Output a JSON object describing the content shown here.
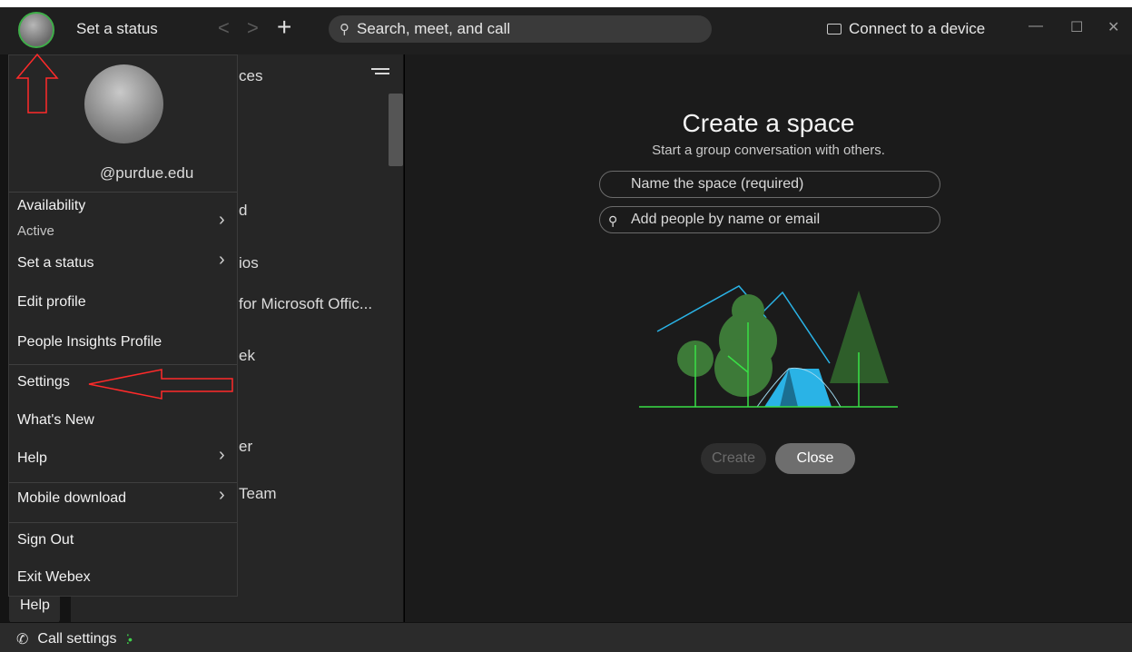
{
  "topbar": {
    "set_status": "Set a status",
    "back_glyph": "<",
    "forward_glyph": ">",
    "plus_glyph": "+",
    "search_placeholder": "Search, meet, and call",
    "connect_device": "Connect to a device",
    "minimize_glyph": "—",
    "maximize_glyph": "☐",
    "close_glyph": "✕"
  },
  "list_fragments": [
    "ces",
    "d",
    "ios",
    "for Microsoft Offic...",
    "ek",
    "er",
    "Team"
  ],
  "profile_menu": {
    "email": "@purdue.edu",
    "availability_label": "Availability",
    "availability_value": "Active",
    "items": {
      "set_status": "Set a status",
      "edit_profile": "Edit profile",
      "people_insights": "People Insights Profile",
      "settings": "Settings",
      "whats_new": "What's New",
      "help": "Help",
      "mobile_download": "Mobile download",
      "sign_out": "Sign Out",
      "exit_webex": "Exit Webex"
    }
  },
  "create_space": {
    "title": "Create a space",
    "subtitle": "Start a group conversation with others.",
    "name_placeholder": "Name the space (required)",
    "people_placeholder": "Add people by name or email",
    "create_label": "Create",
    "close_label": "Close"
  },
  "rail": {
    "help_label": "Help"
  },
  "bottombar": {
    "call_settings": "Call settings"
  },
  "colors": {
    "presence": "#3fae49",
    "annotation": "#ff2a2a",
    "tent": "#2ab3e6",
    "tree_dark": "#2e5e2a",
    "tree_mid": "#3d7a38"
  }
}
